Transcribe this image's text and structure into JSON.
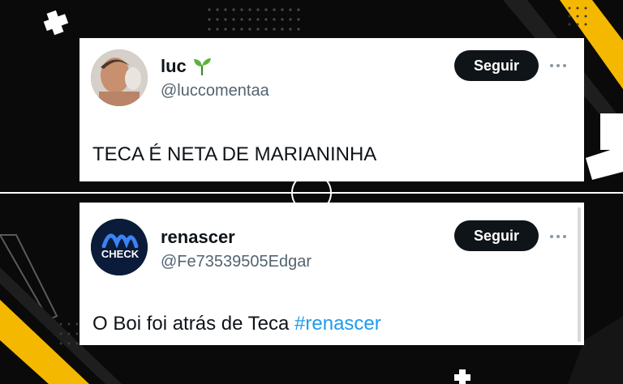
{
  "tweets": [
    {
      "name": "luc",
      "handle": "@luccomentaa",
      "follow_label": "Seguir",
      "text": "TECA É NETA DE MARIANINHA",
      "avatar_icon": "profile-photo",
      "badge_icon": "sprout-icon"
    },
    {
      "name": "renascer",
      "handle": "@Fe73539505Edgar",
      "follow_label": "Seguir",
      "text": "O Boi foi atrás de Teca",
      "hashtag": "#renascer",
      "avatar_text": "CHECK"
    }
  ],
  "colors": {
    "background": "#0a0a0a",
    "accent_yellow": "#f5b800",
    "text_primary": "#0f1419",
    "text_secondary": "#536471",
    "hashtag": "#1d9bf0",
    "button": "#0f1419"
  }
}
